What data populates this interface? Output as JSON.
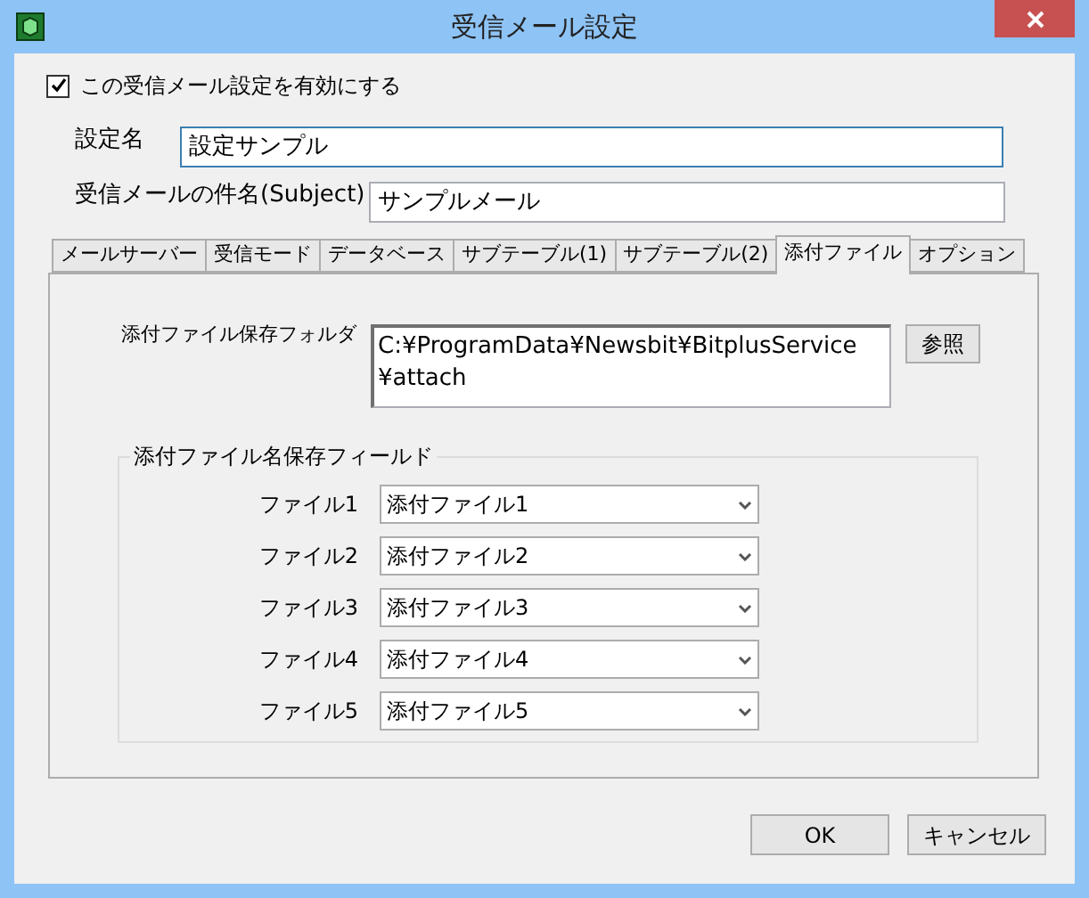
{
  "window": {
    "title": "受信メール設定"
  },
  "enable": {
    "label": "この受信メール設定を有効にする",
    "checked": true
  },
  "name_field": {
    "label": "設定名",
    "value": "設定サンプル",
    "focused": true
  },
  "subject_field": {
    "label": "受信メールの件名(Subject)",
    "value": "サンプルメール"
  },
  "tabs": [
    {
      "label": "メールサーバー",
      "selected": false
    },
    {
      "label": "受信モード",
      "selected": false
    },
    {
      "label": "データベース",
      "selected": false
    },
    {
      "label": "サブテーブル(1)",
      "selected": false
    },
    {
      "label": "サブテーブル(2)",
      "selected": false
    },
    {
      "label": "添付ファイル",
      "selected": true
    },
    {
      "label": "オプション",
      "selected": false
    }
  ],
  "folder": {
    "label": "添付ファイル保存フォルダ",
    "value_lines": [
      "C:¥ProgramData¥Newsbit¥BitplusService",
      "¥attach"
    ],
    "browse_button": "参照"
  },
  "field_group": {
    "title": "添付ファイル名保存フィールド",
    "rows": [
      {
        "label": "ファイル1",
        "value": "添付ファイル1"
      },
      {
        "label": "ファイル2",
        "value": "添付ファイル2"
      },
      {
        "label": "ファイル3",
        "value": "添付ファイル3"
      },
      {
        "label": "ファイル4",
        "value": "添付ファイル4"
      },
      {
        "label": "ファイル5",
        "value": "添付ファイル5"
      }
    ]
  },
  "buttons": [
    "OK",
    "キャンセル"
  ]
}
